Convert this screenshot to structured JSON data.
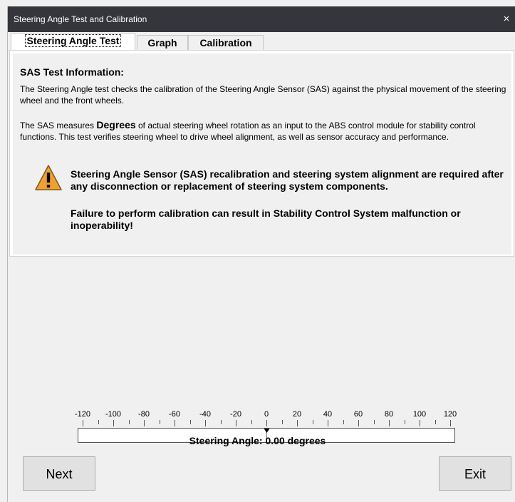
{
  "window": {
    "title": "Steering Angle Test and Calibration",
    "close_glyph": "×"
  },
  "tabs": [
    {
      "label": "Steering Angle Test",
      "active": true
    },
    {
      "label": "Graph",
      "active": false
    },
    {
      "label": "Calibration",
      "active": false
    }
  ],
  "info": {
    "heading": "SAS Test Information:",
    "p1": "The Steering Angle test checks the calibration of the Steering Angle Sensor (SAS) against the physical movement of the steering wheel and the front wheels.",
    "p2_pre": "The SAS measures ",
    "p2_bold": "Degrees",
    "p2_post": " of actual steering wheel rotation as an input to the ABS control module for stability control functions. This test verifies steering wheel to drive wheel alignment, as well as sensor accuracy and performance.",
    "warning_icon": "warning-triangle-icon",
    "warning1": "Steering Angle Sensor (SAS) recalibration and steering system alignment are required after any disconnection or replacement of steering system components.",
    "warning2": "Failure to perform calibration can result in Stability Control System malfunction or inoperability!"
  },
  "gauge": {
    "min": -120,
    "max": 120,
    "major_step": 20,
    "minor_step": 10,
    "value": 0.0,
    "tick_labels": [
      "-120",
      "-100",
      "-80",
      "-60",
      "-40",
      "-20",
      "0",
      "20",
      "40",
      "60",
      "80",
      "100",
      "120"
    ],
    "readout": "Steering Angle: 0.00 degrees"
  },
  "buttons": {
    "next": "Next",
    "exit": "Exit"
  },
  "colors": {
    "titlebar": "#34363c",
    "warning_fill": "#f0a030",
    "warning_stroke": "#7a5a20"
  }
}
